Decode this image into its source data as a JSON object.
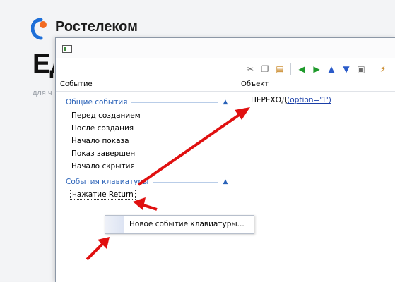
{
  "background": {
    "brand_name": "Ростелеком",
    "heading": "Ед",
    "subtext": "для ч"
  },
  "toolbar": {
    "buttons": [
      "cut-icon",
      "copy-icon",
      "paste-icon",
      "arrow-left-icon",
      "arrow-right-icon",
      "arrow-up-icon",
      "arrow-down-icon",
      "properties-icon",
      "action-icon"
    ]
  },
  "left_panel": {
    "header": "Событие",
    "groups": [
      {
        "title": "Общие события",
        "items": [
          "Перед созданием",
          "После создания",
          "Начало показа",
          "Показ завершен",
          "Начало скрытия"
        ]
      },
      {
        "title": "События клавиатуры",
        "items": [
          "нажатие  Return"
        ]
      }
    ]
  },
  "right_panel": {
    "header": "Объект",
    "action_name": "ПЕРЕХОД",
    "action_param": "(option='1')"
  },
  "popup": {
    "item": "Новое событие клавиатуры..."
  },
  "colors": {
    "accent_blue": "#2a62b8",
    "annotation_red": "#e01010",
    "brand_orange": "#f26a21"
  }
}
